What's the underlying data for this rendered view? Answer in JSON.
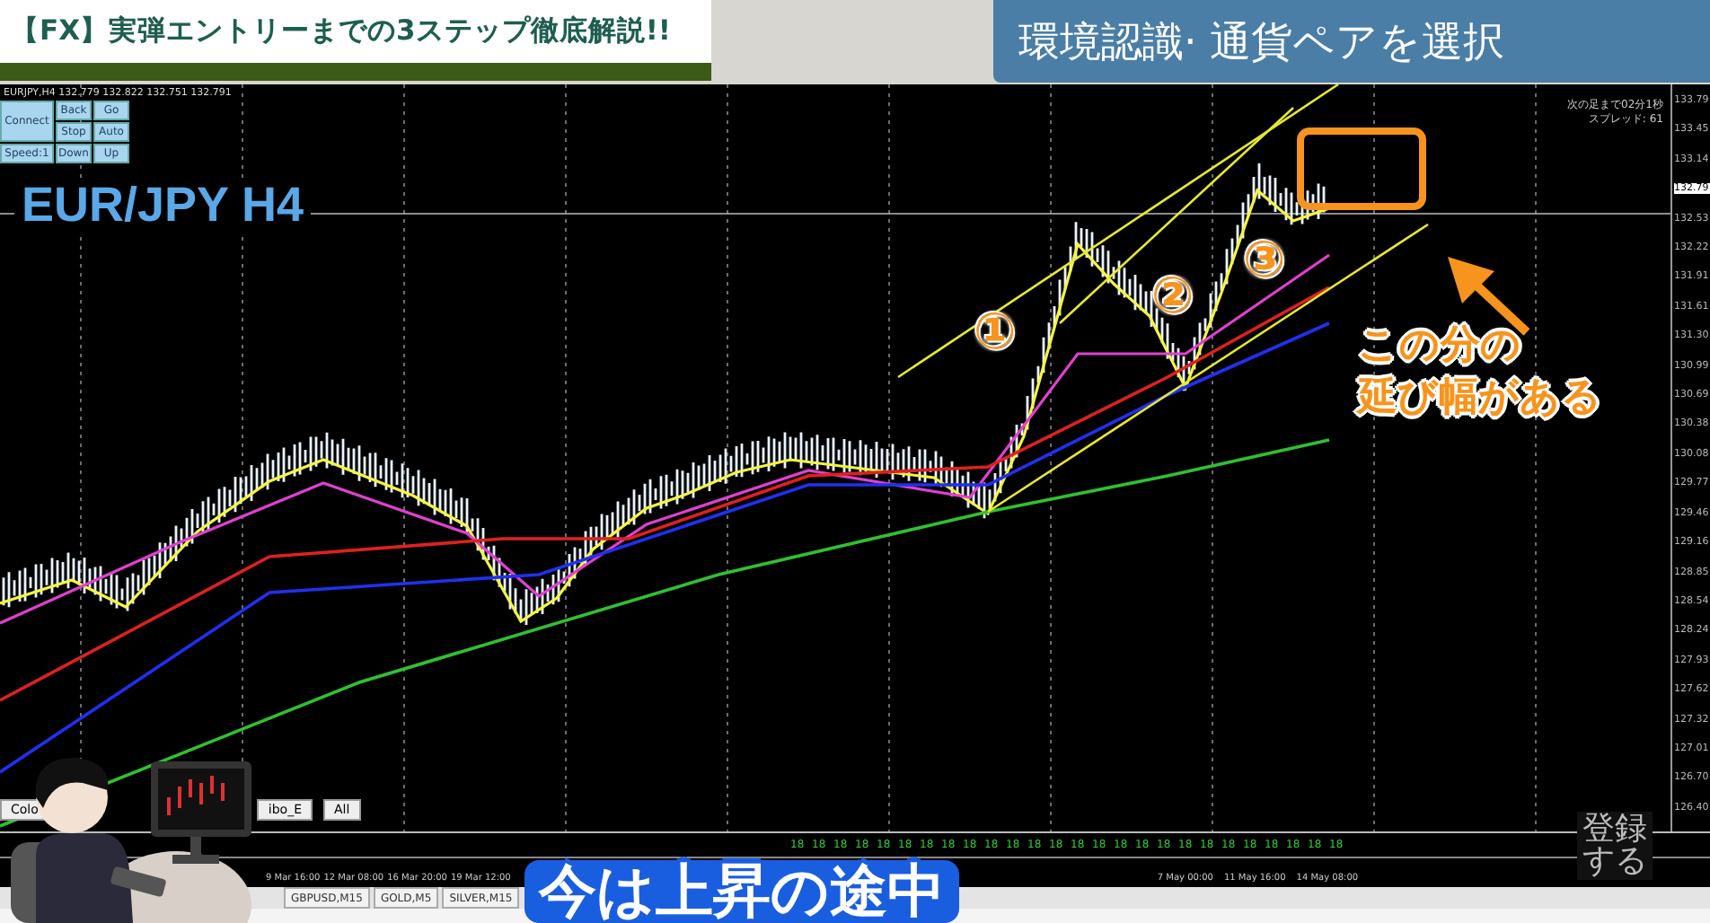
{
  "video_title": "【FX】実弾エントリーまでの3ステップ徹底解説!!",
  "section_banner": "環境認識· 通貨ペアを選択",
  "chart": {
    "info": "EURJPY,H4 132.779 132.822 132.751 132.791",
    "control_panel": [
      "Connect",
      "Back",
      "Go",
      "Stop",
      "Auto",
      "Speed:1",
      "Down",
      "Up"
    ],
    "symbol_label": "EUR/JPY H4",
    "countdown": "次の足まで02分1秒",
    "spread": "スプレッド: 61",
    "wave_labels": [
      "①",
      "②",
      "③"
    ],
    "callout": [
      "この分の",
      "延び幅がある"
    ],
    "buttons": [
      "Colo",
      "ibo_E",
      "All"
    ],
    "price_axis": [
      {
        "label": "133.79",
        "current": false
      },
      {
        "label": "133.45",
        "current": false
      },
      {
        "label": "133.14",
        "current": false
      },
      {
        "label": "132.79",
        "current": true
      },
      {
        "label": "132.53",
        "current": false
      },
      {
        "label": "132.22",
        "current": false
      },
      {
        "label": "131.91",
        "current": false
      },
      {
        "label": "131.61",
        "current": false
      },
      {
        "label": "131.30",
        "current": false
      },
      {
        "label": "130.99",
        "current": false
      },
      {
        "label": "130.69",
        "current": false
      },
      {
        "label": "130.38",
        "current": false
      },
      {
        "label": "130.08",
        "current": false
      },
      {
        "label": "129.77",
        "current": false
      },
      {
        "label": "129.46",
        "current": false
      },
      {
        "label": "129.16",
        "current": false
      },
      {
        "label": "128.85",
        "current": false
      },
      {
        "label": "128.54",
        "current": false
      },
      {
        "label": "128.24",
        "current": false
      },
      {
        "label": "127.93",
        "current": false
      },
      {
        "label": "127.62",
        "current": false
      },
      {
        "label": "127.32",
        "current": false
      },
      {
        "label": "127.01",
        "current": false
      },
      {
        "label": "126.70",
        "current": false
      },
      {
        "label": "126.40",
        "current": false
      }
    ],
    "indicator_marks": [
      "18",
      "18",
      "18",
      "18",
      "18",
      "18",
      "18",
      "18",
      "18",
      "18",
      "18",
      "18",
      "18",
      "18",
      "18",
      "18",
      "18",
      "18",
      "18",
      "18",
      "18",
      "18",
      "18",
      "18",
      "18",
      "18"
    ],
    "time_axis_left": [
      "9 Mar 16:00",
      "12 Mar 08:00",
      "16 Mar 20:00",
      "19 Mar 12:00"
    ],
    "time_axis_right": [
      "7 May 00:00",
      "11 May 16:00",
      "14 May 08:00"
    ]
  },
  "symbol_tabs": [
    "GBPUSD,M15",
    "GOLD,M5",
    "SILVER,M15"
  ],
  "subtitle": "今は上昇の途中",
  "subscribe": [
    "登録",
    "する"
  ]
}
